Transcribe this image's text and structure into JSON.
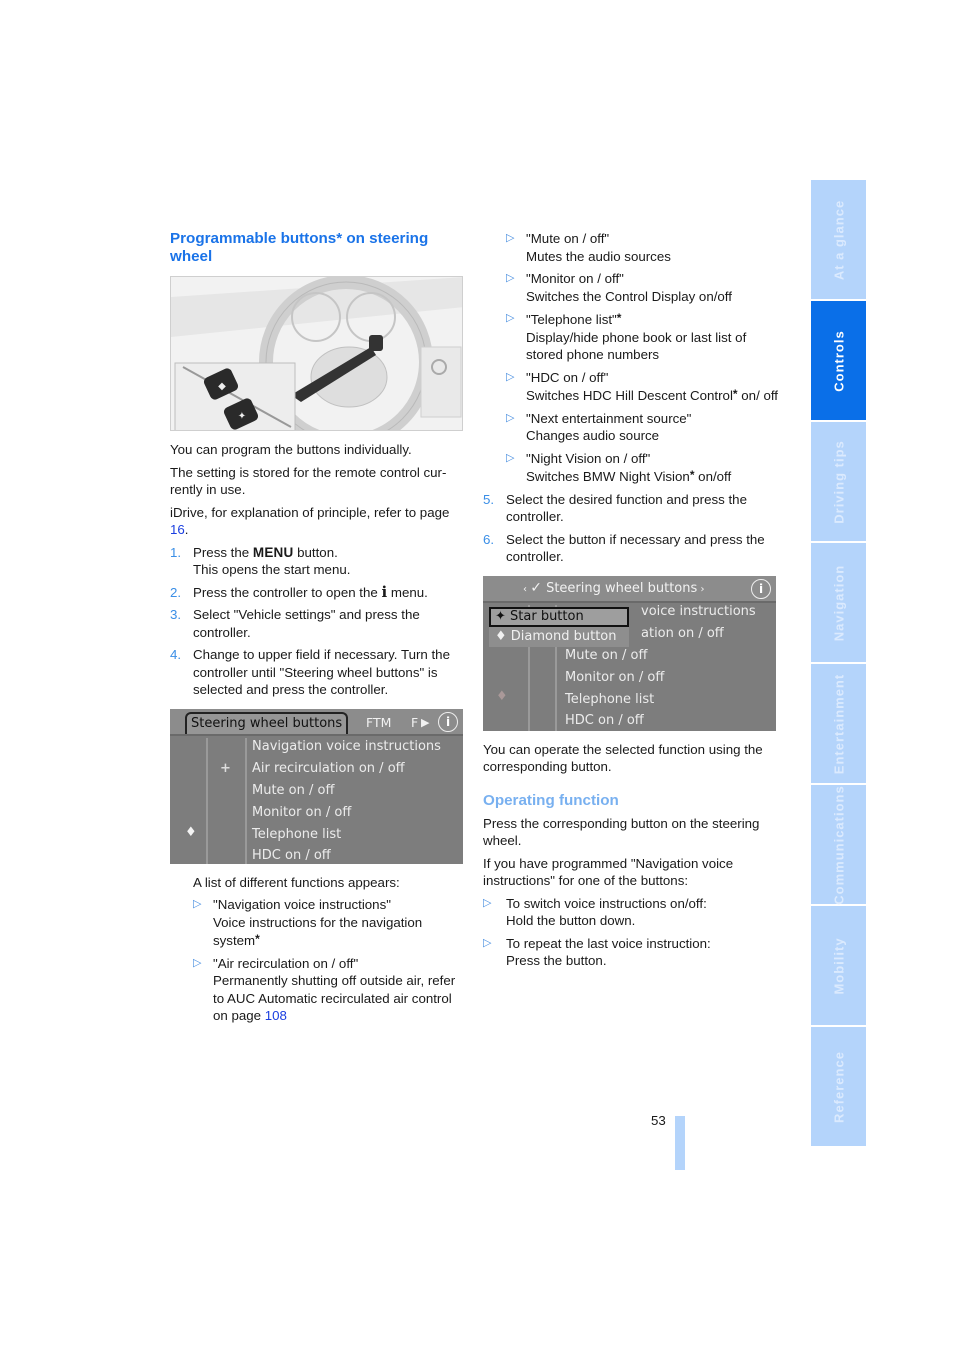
{
  "left_column": {
    "heading": "Programmable buttons* on steering wheel",
    "intro": [
      "You can program the buttons individually.",
      "The setting is stored for the remote control cur-rently in use."
    ],
    "idrive_ref_text": "iDrive, for explanation of principle, refer to page ",
    "idrive_ref_page": "16",
    "idrive_ref_end": ".",
    "steps": [
      {
        "num": "1.",
        "before": "Press the ",
        "button_word": "MENU",
        "after": " button.",
        "line2": "This opens the start menu."
      },
      {
        "num": "2.",
        "before": "Press the controller to open the ",
        "icon_glyph": "i",
        "after": " menu."
      },
      {
        "num": "3.",
        "text": "Select \"Vehicle settings\" and press the controller."
      },
      {
        "num": "4.",
        "text": "Change to upper field if necessary. Turn the controller until \"Steering wheel buttons\" is selected and press the controller."
      }
    ],
    "list_intro": "A list of different functions appears:",
    "functions": [
      {
        "name": "\"Navigation voice instructions\"",
        "desc": "Voice instructions for the navigation system",
        "star": "*"
      },
      {
        "name": "\"Air recirculation on / off\"",
        "desc": "Permanently shutting off outside air, refer to AUC Automatic recirculated air control on page ",
        "page": "108"
      }
    ]
  },
  "screen1": {
    "active_tab": "Steering wheel buttons",
    "tab_ftm": "FTM",
    "tab_f": "F",
    "tab_arrow": "▶",
    "info": "i",
    "star_glyph": "+",
    "diamond_glyph": "♦",
    "items": [
      "Navigation voice instructions",
      "Air recirculation on / off",
      "Mute on / off",
      "Monitor on / off",
      "Telephone list",
      "HDC on / off"
    ]
  },
  "right_column": {
    "functions": [
      {
        "name": "\"Mute on / off\"",
        "desc": "Mutes the audio sources"
      },
      {
        "name": "\"Monitor on / off\"",
        "desc": "Switches the Control Display on/off"
      },
      {
        "name": "\"Telephone list\"",
        "name_star": "*",
        "desc": "Display/hide phone book or last list of stored phone numbers"
      },
      {
        "name": "\"HDC on / off\"",
        "desc_before": "Switches HDC Hill Descent Control",
        "desc_star": "*",
        "desc_after": " on/ off"
      },
      {
        "name": "\"Next entertainment source\"",
        "desc": "Changes audio source"
      },
      {
        "name": "\"Night Vision on / off\"",
        "desc_before": "Switches BMW Night Vision",
        "desc_star": "*",
        "desc_after": " on/off"
      }
    ],
    "steps": [
      {
        "num": "5.",
        "text": "Select the desired function and press the controller."
      },
      {
        "num": "6.",
        "text": "Select the button if necessary and press the controller."
      }
    ],
    "after_screen": "You can operate the selected function using the corresponding button.",
    "operating_heading": "Operating function",
    "operating_text": [
      "Press the corresponding button on the steering wheel.",
      "If you have programmed \"Navigation voice instructions\" for one of the buttons:"
    ],
    "operating_items": [
      {
        "line1": "To switch voice instructions on/off:",
        "line2": "Hold the button down."
      },
      {
        "line1": "To repeat the last voice instruction:",
        "line2": "Press the button."
      }
    ]
  },
  "screen2": {
    "title": "Steering wheel buttons",
    "info": "i",
    "popup_star": "✦ Star button",
    "popup_diamond": "♦ Diamond button",
    "partial_items": [
      "voice instructions",
      "ation on / off"
    ],
    "items": [
      "Mute on / off",
      "Monitor on / off",
      "Telephone list",
      "HDC on / off"
    ],
    "diamond_glyph": "♦"
  },
  "chapter_tabs": [
    {
      "label": "At a glance",
      "active": false
    },
    {
      "label": "Controls",
      "active": true
    },
    {
      "label": "Driving tips",
      "active": false
    },
    {
      "label": "Navigation",
      "active": false
    },
    {
      "label": "Entertainment",
      "active": false
    },
    {
      "label": "Communications",
      "active": false
    },
    {
      "label": "Mobility",
      "active": false
    },
    {
      "label": "Reference",
      "active": false
    }
  ],
  "bullet_glyph": "▷",
  "page_number": "53",
  "colors": {
    "heading_blue": "#1a73e8",
    "subheading_light_blue": "#78b0f0",
    "link_blue": "#1a3ee0",
    "tab_inactive": "#b4d4fb",
    "tab_active": "#0a6fe8"
  }
}
